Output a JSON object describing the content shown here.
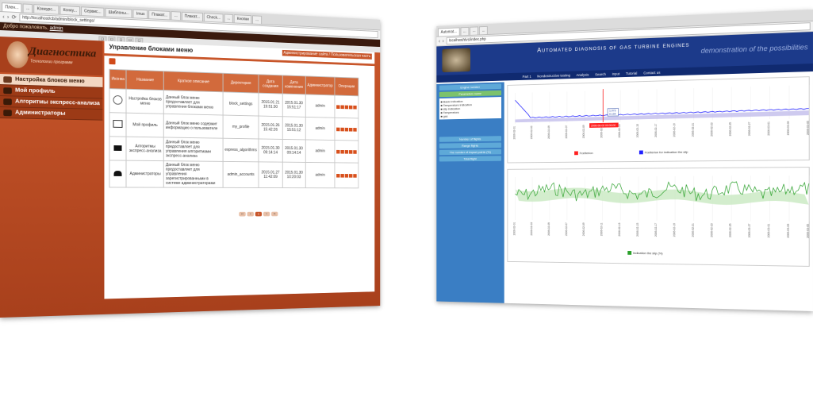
{
  "left_window": {
    "tabs": [
      "Плен...",
      "...",
      "Конкурс...",
      "Конку...",
      "Сервис...",
      "Шаблоны...",
      "Imus",
      "Плакат...",
      "...",
      "Плакат...",
      "Check...",
      "...",
      "Кнопки",
      "..."
    ],
    "url": "http://localhost/cb/admin/block_settings/",
    "welcome_text": "Добро пожаловать,",
    "welcome_user": "admin",
    "logo_title": "Диагностика",
    "logo_subtitle": "Технологии программ",
    "menu": [
      {
        "label": "Настройка блоков меню",
        "active": true
      },
      {
        "label": "Мой профиль",
        "active": false
      },
      {
        "label": "Алгоритмы экспресс-анализа",
        "active": false
      },
      {
        "label": "Администраторы",
        "active": false
      }
    ],
    "page_title": "Управление блоками меню",
    "header_right": "Администрирование сайта / Пользовательская часть",
    "table": {
      "headers": [
        "Иконка",
        "Название",
        "Краткое описание",
        "Директория",
        "Дата создания",
        "Дата изменения",
        "Администратор",
        "Операции"
      ],
      "rows": [
        {
          "icon": "gear-icon",
          "name": "Настройка блоков меню",
          "desc": "Данный блок меню предоставляет для управления блоками меню",
          "dir": "block_settings",
          "created": "2015.01.21 19:51:30",
          "modified": "2015.01.30 15:51:17",
          "admin": "admin"
        },
        {
          "icon": "card-icon",
          "name": "Мой профиль",
          "desc": "Данный блок меню содержит информацию о пользователе",
          "dir": "my_profile",
          "created": "2015.01.26 15:42:26",
          "modified": "2015.01.30 15:51:12",
          "admin": "admin"
        },
        {
          "icon": "book-icon",
          "name": "Алгоритмы экспресс-анализа",
          "desc": "Данный блок меню предоставляет для управления алгоритмами экспресс-анализа",
          "dir": "express_algorithms",
          "created": "2015.01.30 09:14:14",
          "modified": "2015.01.30 09:14:14",
          "admin": "admin"
        },
        {
          "icon": "users-icon",
          "name": "Администраторы",
          "desc": "Данный блок меню предоставляет для управления зарегистрированными в системе администраторами",
          "dir": "admin_accounts",
          "created": "2015.01.27 11:42:09",
          "modified": "2015.01.30 10:20:03",
          "admin": "admin"
        }
      ]
    },
    "pager": [
      "‹‹",
      "‹",
      "1",
      "›",
      "››"
    ]
  },
  "right_window": {
    "url": "localhost/dvs/index.php",
    "title": "Automated diagnosis of gas turbine engines",
    "subtitle": "demonstration of the possibilities",
    "nav": [
      "Part 1",
      "Nondestructive testing",
      "Analysis",
      "Search",
      "Input",
      "Tutorial",
      "Contact us"
    ],
    "side": {
      "top_bars": [
        "Engine number",
        "Parameters name"
      ],
      "list": [
        "Basic indication",
        "Temperature indication",
        "slip indication",
        "Temperature",
        "gas"
      ],
      "bottom_bars": [
        "Number of flights",
        "Range flights",
        "The number of impact points (%)",
        "Total flight"
      ]
    },
    "chart1_legend": [
      "Fcetterion",
      "Fcetterion for indication the slip"
    ],
    "chart1_tooltip": [
      "1.073",
      "0.104"
    ],
    "chart1_marker": "2006-06-02 00:00:00",
    "chart2_legend": [
      "Indication the slip (%)"
    ],
    "x_ticks": [
      "2006-02-01",
      "2006-02-03",
      "2006-02-05",
      "2006-02-07",
      "2006-02-09",
      "2006-02-11",
      "2006-02-13",
      "2006-02-15",
      "2006-02-17",
      "2006-02-19",
      "2006-02-21",
      "2006-02-23",
      "2006-02-25",
      "2006-02-27",
      "2006-03-01",
      "2006-03-03",
      "2006-03-05"
    ],
    "colors": {
      "series1": "#ff2020",
      "series2": "#2020ff",
      "series3": "#2aa02a"
    }
  }
}
